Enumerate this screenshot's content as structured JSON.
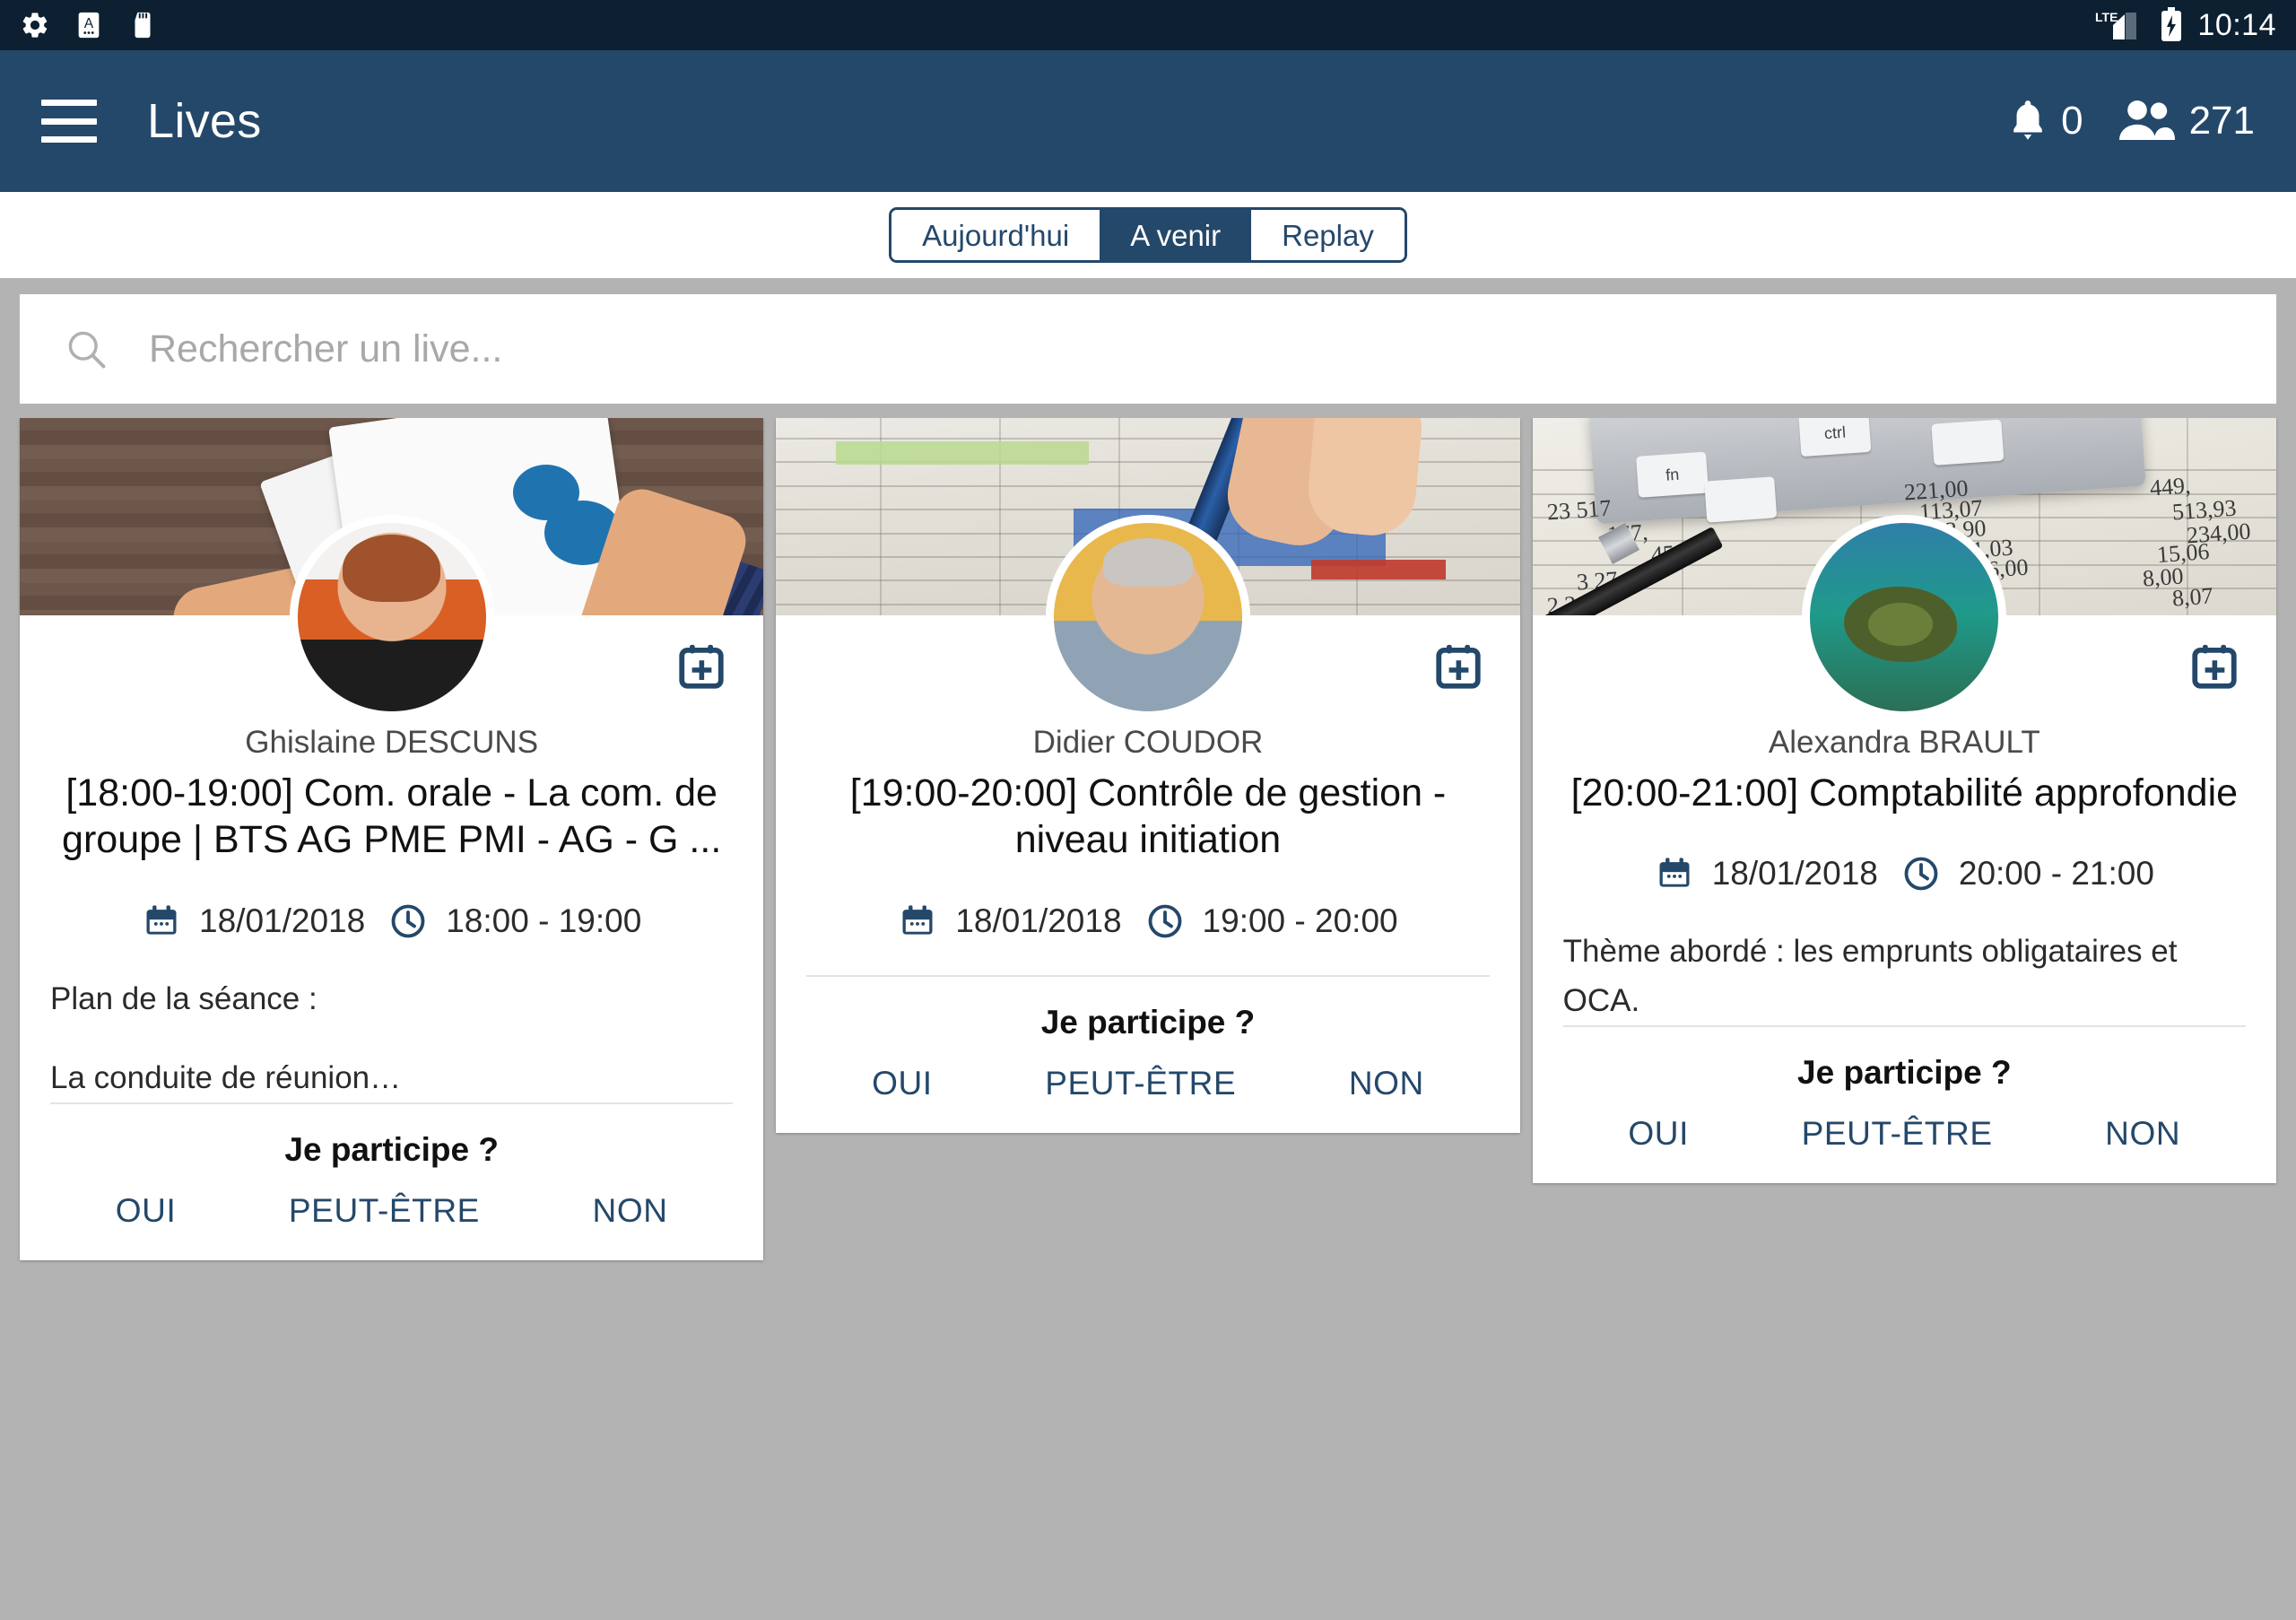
{
  "status_bar": {
    "icons": [
      "gear-icon",
      "keyboard-language-icon",
      "sd-card-icon"
    ],
    "network": "LTE",
    "battery": "charging",
    "time": "10:14"
  },
  "app_bar": {
    "menu_icon": "hamburger-menu-icon",
    "title": "Lives",
    "notifications": {
      "icon": "bell-icon",
      "count": "0"
    },
    "participants": {
      "icon": "people-icon",
      "count": "271"
    }
  },
  "tabs": {
    "items": [
      {
        "label": "Aujourd'hui",
        "active": false
      },
      {
        "label": "A venir",
        "active": true
      },
      {
        "label": "Replay",
        "active": false
      }
    ]
  },
  "search": {
    "icon": "search-icon",
    "placeholder": "Rechercher un live...",
    "value": ""
  },
  "cards": [
    {
      "banner": "illustration-hands-papers",
      "avatar": "photo-woman-orange-top",
      "add_to_calendar_icon": "calendar-plus-icon",
      "presenter": "Ghislaine DESCUNS",
      "title": "[18:00-19:00] Com. orale - La com. de groupe | BTS AG PME PMI - AG - G ...",
      "date_icon": "calendar-icon",
      "date": "18/01/2018",
      "time_icon": "clock-icon",
      "time": "18:00 - 19:00",
      "description_lines": [
        "Plan de la séance :",
        "La conduite de réunion…"
      ],
      "participate_label": "Je participe ?",
      "answers": [
        "OUI",
        "PEUT-ÊTRE",
        "NON"
      ]
    },
    {
      "banner": "photo-spreadsheet-pen",
      "avatar": "photo-man-grey-shirt",
      "add_to_calendar_icon": "calendar-plus-icon",
      "presenter": "Didier COUDOR",
      "title": "[19:00-20:00] Contrôle de gestion - niveau initiation",
      "date_icon": "calendar-icon",
      "date": "18/01/2018",
      "time_icon": "clock-icon",
      "time": "19:00 - 20:00",
      "description_lines": [],
      "participate_label": "Je participe ?",
      "answers": [
        "OUI",
        "PEUT-ÊTRE",
        "NON"
      ]
    },
    {
      "banner": "photo-calculator-accounting",
      "avatar": "photo-sea-turtle",
      "add_to_calendar_icon": "calendar-plus-icon",
      "presenter": "Alexandra BRAULT",
      "title": "[20:00-21:00] Comptabilité approfondie",
      "date_icon": "calendar-icon",
      "date": "18/01/2018",
      "time_icon": "clock-icon",
      "time": "20:00 - 21:00",
      "description_lines": [
        "Thème abordé : les emprunts obligataires et OCA."
      ],
      "participate_label": "Je participe ?",
      "answers": [
        "OUI",
        "PEUT-ÊTRE",
        "NON"
      ]
    }
  ],
  "colors": {
    "status_bar_bg": "#0c2031",
    "app_bar_bg": "#24486a",
    "accent": "#24486a",
    "page_bg": "#b3b3b3",
    "card_bg": "#ffffff"
  },
  "banner3_numbers": [
    "221,00",
    "113,07",
    "33,90",
    "449,",
    "513,93",
    "301,03",
    "234,00",
    "15,06",
    "856,00",
    "8,00",
    "23,",
    "8,07",
    "23 517",
    "167,",
    "45,98",
    "3 27",
    "2 2"
  ]
}
